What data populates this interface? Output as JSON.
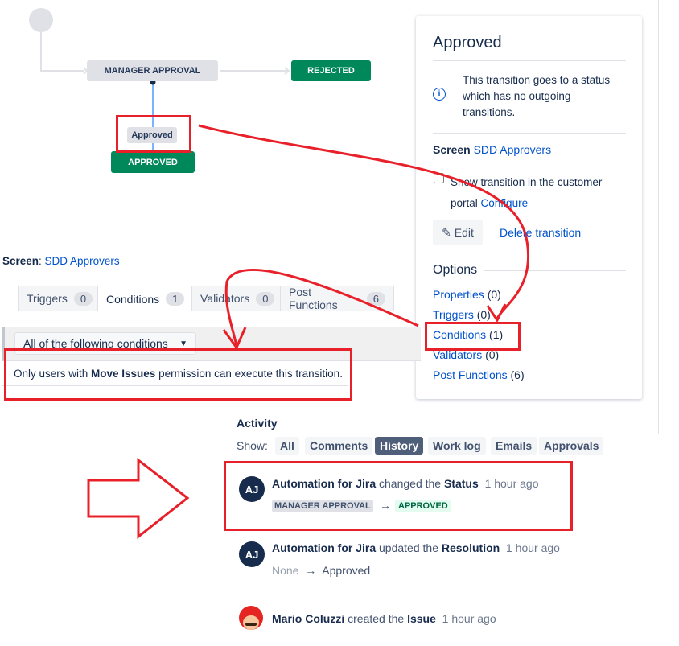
{
  "diagram": {
    "manager_approval": "MANAGER APPROVAL",
    "rejected": "REJECTED",
    "transition_label": "Approved",
    "approved": "APPROVED",
    "colors": {
      "status_gray": "#dfe1e6",
      "status_green": "#00875a"
    }
  },
  "panel": {
    "title": "Approved",
    "info": "This transition goes to a status which has no outgoing transitions.",
    "screen_label": "Screen",
    "screen_value": "SDD Approvers",
    "checkbox_label": "Show transition in the customer portal",
    "configure": "Configure",
    "edit": "Edit",
    "delete": "Delete transition",
    "options_heading": "Options",
    "options": [
      {
        "label": "Properties",
        "count": "(0)"
      },
      {
        "label": "Triggers",
        "count": "(0)"
      },
      {
        "label": "Conditions",
        "count": "(1)"
      },
      {
        "label": "Validators",
        "count": "(0)"
      },
      {
        "label": "Post Functions",
        "count": "(6)"
      }
    ]
  },
  "editor": {
    "screen_label": "Screen",
    "screen_value": "SDD Approvers",
    "tabs": [
      {
        "label": "Triggers",
        "count": "0"
      },
      {
        "label": "Conditions",
        "count": "1"
      },
      {
        "label": "Validators",
        "count": "0"
      },
      {
        "label": "Post Functions",
        "count": "6"
      }
    ],
    "select_value": "All of the following conditions",
    "condition_pre": "Only users with ",
    "condition_bold": "Move Issues",
    "condition_post": " permission can execute this transition."
  },
  "activity": {
    "heading": "Activity",
    "show_label": "Show:",
    "filters": [
      "All",
      "Comments",
      "History",
      "Work log",
      "Emails",
      "Approvals"
    ],
    "active_filter": "History",
    "entries": [
      {
        "initials": "AJ",
        "actor": "Automation for Jira",
        "verb": "changed the",
        "field": "Status",
        "time": "1 hour ago",
        "from": "MANAGER APPROVAL",
        "to": "APPROVED"
      },
      {
        "initials": "AJ",
        "actor": "Automation for Jira",
        "verb": "updated the",
        "field": "Resolution",
        "time": "1 hour ago",
        "from": "None",
        "to": "Approved"
      },
      {
        "actor": "Mario Coluzzi",
        "verb": "created the",
        "field": "Issue",
        "time": "1 hour ago"
      }
    ]
  },
  "annotation_color": "#e8202a"
}
